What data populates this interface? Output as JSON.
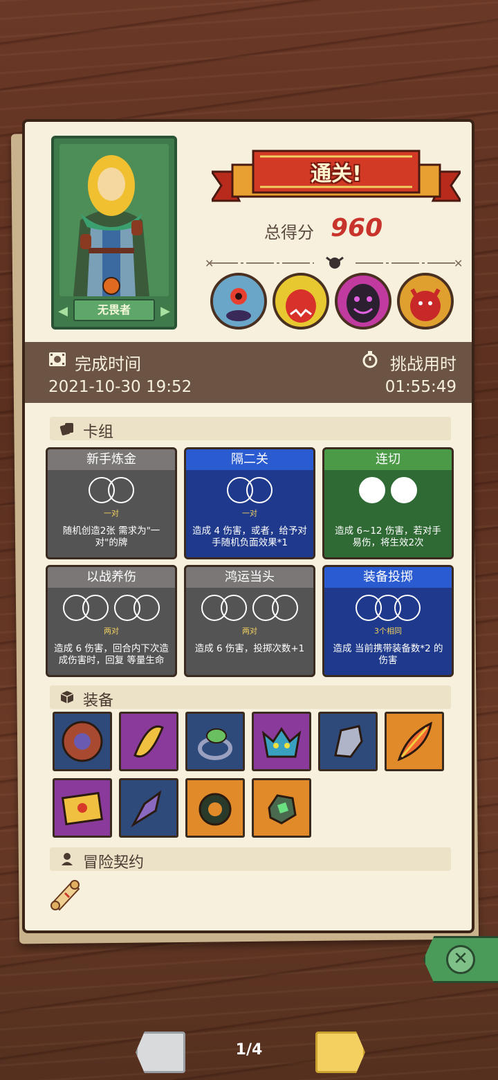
{
  "result": {
    "banner": "通关!",
    "score_label": "总得分",
    "score_value": "960"
  },
  "hero": {
    "name": "无畏者"
  },
  "bosses": [
    "boss-blue-cyclops",
    "boss-red-demon",
    "boss-shadow-beast",
    "boss-red-dragon"
  ],
  "time": {
    "finish_label": "完成时间",
    "finish_value": "2021-10-30 19:52",
    "duration_label": "挑战用时",
    "duration_value": "01:55:49"
  },
  "deck": {
    "title": "卡组",
    "cards": [
      {
        "name": "新手炼金",
        "tag": "一对",
        "desc": "随机创造2张 需求为\"一对\"的牌",
        "style": "gray"
      },
      {
        "name": "隔二关",
        "tag": "一对",
        "desc": "造成 4 伤害，或者，给予对手随机负面效果*1",
        "style": "blue"
      },
      {
        "name": "连切",
        "tag": "",
        "desc": "造成 6~12 伤害，若对手 易伤，将生效2次",
        "style": "green"
      },
      {
        "name": "以战养伤",
        "tag": "两对",
        "desc": "造成 6 伤害，回合内下次造成伤害时，回复 等量生命",
        "style": "gray"
      },
      {
        "name": "鸿运当头",
        "tag": "两对",
        "desc": "造成 6 伤害，投掷次数+1",
        "style": "gray"
      },
      {
        "name": "装备投掷",
        "tag": "3个相同",
        "desc": "造成 当前携带装备数*2 的伤害",
        "style": "blue"
      }
    ]
  },
  "equipment": {
    "title": "装备",
    "items": [
      "round-shield-icon",
      "scroll-charm-icon",
      "leaf-ring-icon",
      "demon-mask-icon",
      "gauntlet-icon",
      "phoenix-feather-icon",
      "spellbook-icon",
      "crystal-dagger-icon",
      "serpent-ring-icon",
      "green-gem-icon"
    ]
  },
  "contract": {
    "title": "冒险契约"
  },
  "nav": {
    "page": "1/4"
  },
  "colors": {
    "score": "#c8342c",
    "gray_card": "#555454",
    "blue_card": "#1f3a8c",
    "green_card": "#2f6a34"
  }
}
